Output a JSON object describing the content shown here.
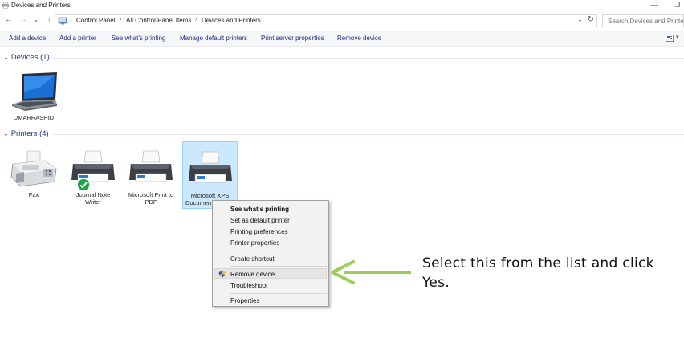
{
  "window": {
    "title": "Devices and Printers",
    "minimize_glyph": "—",
    "restore_glyph": "❐"
  },
  "nav": {
    "back_glyph": "←",
    "forward_glyph": "→",
    "recent_glyph": "⌄",
    "up_glyph": "↑"
  },
  "breadcrumb": {
    "items": [
      "Control Panel",
      "All Control Panel Items",
      "Devices and Printers"
    ],
    "separator": "›",
    "dropdown_glyph": "⌄",
    "refresh_glyph": "↻"
  },
  "search": {
    "placeholder": "Search Devices and Printers"
  },
  "commands": [
    "Add a device",
    "Add a printer",
    "See what's printing",
    "Manage default printers",
    "Print server properties",
    "Remove device"
  ],
  "view_dropdown_glyph": "▾",
  "groups": {
    "devices": {
      "label": "Devices (1)",
      "chevron": "⌄"
    },
    "printers": {
      "label": "Printers (4)",
      "chevron": "⌄"
    }
  },
  "devices": [
    {
      "label": "UMARRASHID",
      "icon": "laptop-icon"
    }
  ],
  "printers": [
    {
      "label_lines": [
        "Fax",
        ""
      ],
      "icon": "fax-icon"
    },
    {
      "label_lines": [
        "Journal Note",
        "Writer"
      ],
      "icon": "printer-icon",
      "default": true
    },
    {
      "label_lines": [
        "Microsoft Print to",
        "PDF"
      ],
      "icon": "printer-icon"
    },
    {
      "label_lines": [
        "Microsoft XPS",
        "Documen"
      ],
      "icon": "printer-icon",
      "selected": true
    }
  ],
  "context_menu": {
    "items": {
      "see_printing": "See what's printing",
      "set_default": "Set as default printer",
      "printing_prefs": "Printing preferences",
      "printer_props": "Printer properties",
      "create_shortcut": "Create shortcut",
      "remove_device": "Remove device",
      "troubleshoot": "Troubleshoot",
      "properties": "Properties"
    }
  },
  "annotation": {
    "text": "Select this from the list and click Yes.",
    "arrow_color": "#9acd5a"
  },
  "colors": {
    "link": "#1e3287",
    "group_header": "#1e3a8a",
    "selection_fill": "#cce8ff",
    "selection_border": "#99d1ff",
    "default_check": "#1fa34a"
  }
}
